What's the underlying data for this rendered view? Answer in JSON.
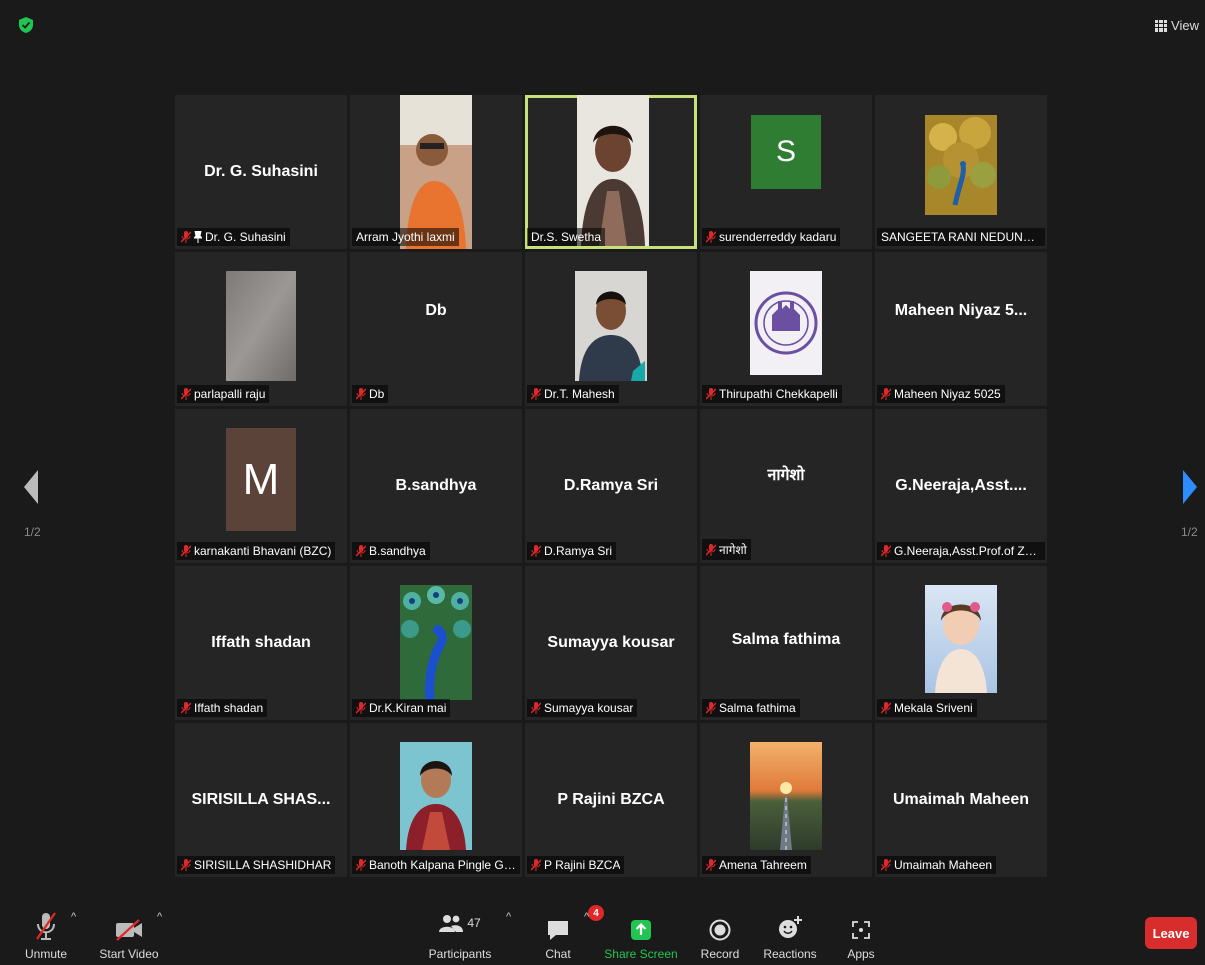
{
  "header": {
    "view_label": "View"
  },
  "pagination": {
    "left": "1/2",
    "right": "1/2"
  },
  "tiles": [
    {
      "name": "Dr. G. Suhasini",
      "label": "Dr. G. Suhasini"
    },
    {
      "name": "",
      "label": "Arram Jyothi laxmi"
    },
    {
      "name": "",
      "label": "Dr.S. Swetha"
    },
    {
      "name": "",
      "label": "surenderreddy kadaru",
      "initial": "S"
    },
    {
      "name": "",
      "label": "SANGEETA RANI NEDUNURI"
    },
    {
      "name": "",
      "label": "parlapalli raju"
    },
    {
      "name": "Db",
      "label": "Db"
    },
    {
      "name": "",
      "label": "Dr.T. Mahesh"
    },
    {
      "name": "",
      "label": "Thirupathi Chekkapelli"
    },
    {
      "name": "Maheen Niyaz 5...",
      "label": "Maheen Niyaz 5025"
    },
    {
      "name": "",
      "label": "karnakanti Bhavani (BZC)",
      "initial": "M"
    },
    {
      "name": "B.sandhya",
      "label": "B.sandhya"
    },
    {
      "name": "D.Ramya Sri",
      "label": "D.Ramya Sri"
    },
    {
      "name": "नागेशो",
      "label": "नागेशो"
    },
    {
      "name": "G.Neeraja,Asst....",
      "label": "G.Neeraja,Asst.Prof.of Zool..."
    },
    {
      "name": "Iffath shadan",
      "label": "Iffath shadan"
    },
    {
      "name": "",
      "label": "Dr.K.Kiran mai"
    },
    {
      "name": "Sumayya kousar",
      "label": "Sumayya kousar"
    },
    {
      "name": "Salma fathima",
      "label": "Salma fathima"
    },
    {
      "name": "",
      "label": "Mekala Sriveni"
    },
    {
      "name": "SIRISILLA SHAS...",
      "label": "SIRISILLA SHASHIDHAR"
    },
    {
      "name": "",
      "label": "Banoth Kalpana Pingle Gov..."
    },
    {
      "name": "P Rajini BZCA",
      "label": "P Rajini BZCA"
    },
    {
      "name": "",
      "label": "Amena Tahreem"
    },
    {
      "name": "Umaimah Maheen",
      "label": "Umaimah Maheen"
    }
  ],
  "toolbar": {
    "unmute": "Unmute",
    "start_video": "Start Video",
    "participants": "Participants",
    "participants_count": "47",
    "chat": "Chat",
    "chat_badge": "4",
    "share_screen": "Share Screen",
    "record": "Record",
    "reactions": "Reactions",
    "apps": "Apps",
    "leave": "Leave"
  },
  "colors": {
    "background": "#1a1a1a",
    "tile": "#252525",
    "active_speaker": "#c8e07a",
    "share_screen": "#23c552",
    "leave": "#d92c2c",
    "mute": "#e02828",
    "nav_arrow_right": "#2d8cff"
  }
}
